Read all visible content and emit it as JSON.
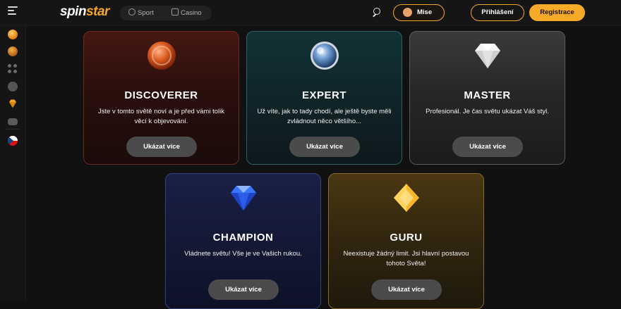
{
  "header": {
    "logo_part1": "spin",
    "logo_part2": "star",
    "nav": [
      {
        "label": "Sport",
        "icon": "soccer-ball-icon"
      },
      {
        "label": "Casino",
        "icon": "casino-chip-icon"
      }
    ],
    "mise_label": "Mise",
    "login_label": "Přihlášení",
    "register_label": "Registrace"
  },
  "sidebar": {
    "icons": [
      "coin-icon",
      "cookie-icon",
      "grid-dots-icon",
      "settings-icon",
      "diamond-icon",
      "chat-icon",
      "czech-flag-icon"
    ]
  },
  "colors": {
    "accent": "#f7a928",
    "background": "#111111",
    "button": "#4b4b4b"
  },
  "levels": [
    {
      "title": "DISCOVERER",
      "desc": "Jste v tomto světě noví a je před vámi tolik věcí k objevování.",
      "button": "Ukázat více",
      "badge": "copper-coin-icon"
    },
    {
      "title": "EXPERT",
      "desc": "Už víte, jak to tady chodí, ale ještě byste měli zvládnout něco většího...",
      "button": "Ukázat více",
      "badge": "blue-orb-icon"
    },
    {
      "title": "MASTER",
      "desc": "Profesionál. Je čas světu ukázat Váš styl.",
      "button": "Ukázat více",
      "badge": "white-diamond-icon"
    },
    {
      "title": "CHAMPION",
      "desc": "Vládnete světu! Vše je ve Vašich rukou.",
      "button": "Ukázat více",
      "badge": "blue-diamond-icon"
    },
    {
      "title": "GURU",
      "desc": "Neexistuje žádný limit. Jsi hlavní postavou tohoto Světa!",
      "button": "Ukázat více",
      "badge": "gold-gem-icon"
    }
  ]
}
